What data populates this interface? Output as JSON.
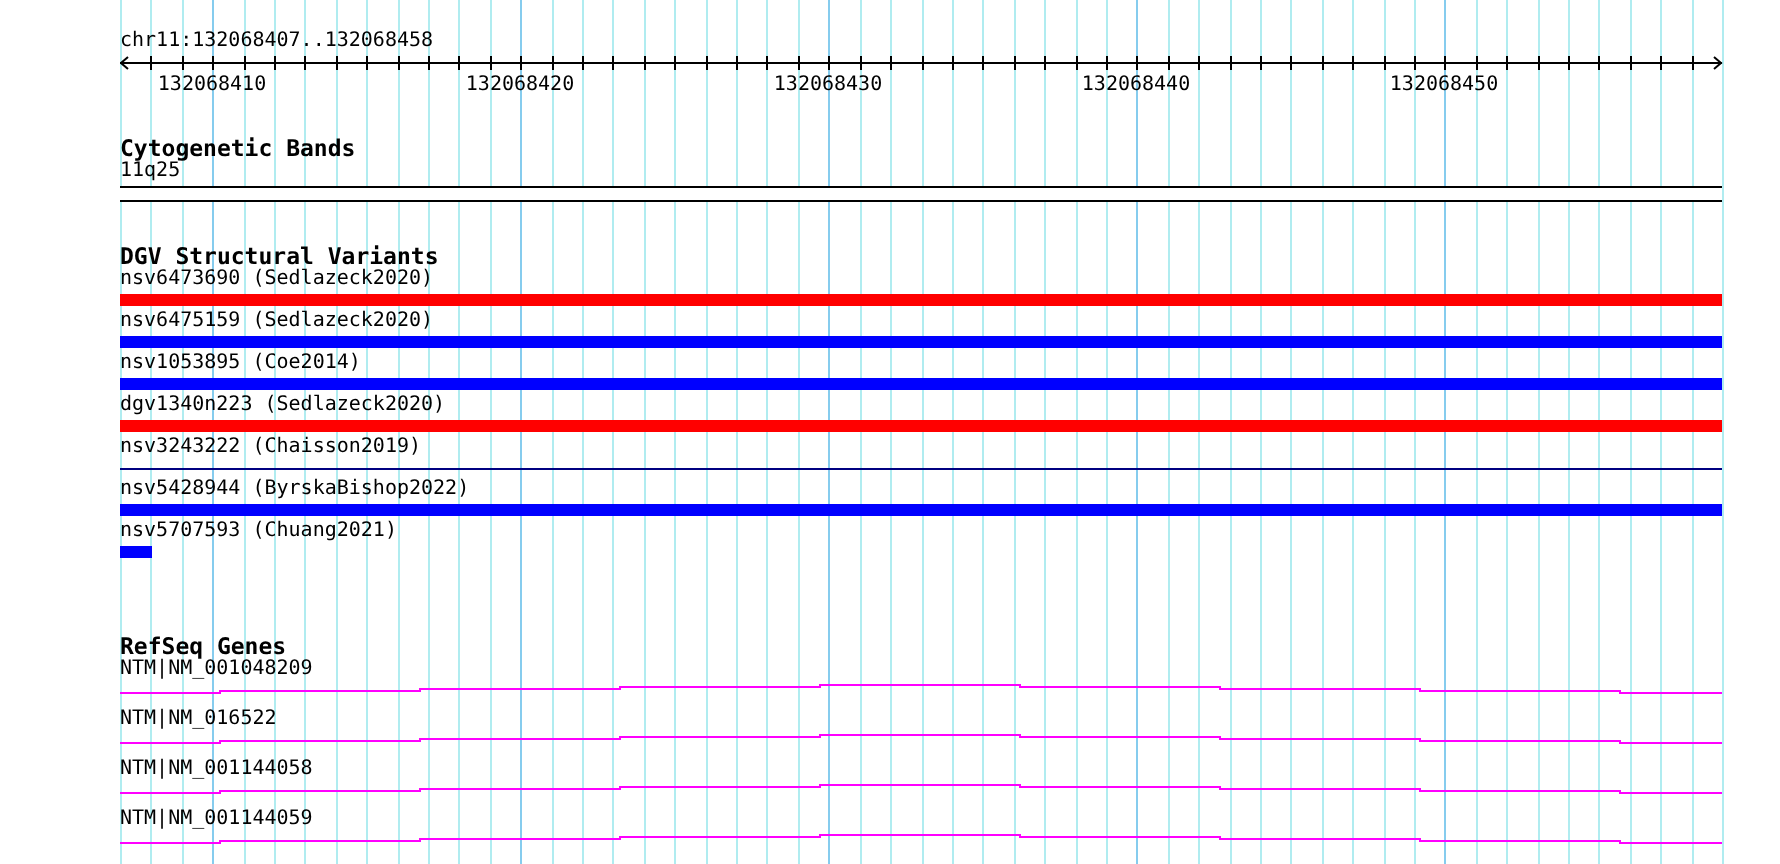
{
  "ruler": {
    "location": "chr11:132068407..132068458",
    "ticks": [
      "132068410",
      "132068420",
      "132068430",
      "132068440",
      "132068450"
    ]
  },
  "tracks": [
    {
      "kind": "cytoband",
      "title": "Cytogenetic Bands",
      "features": [
        {
          "label": "11q25"
        }
      ]
    },
    {
      "kind": "variants",
      "title": "DGV Structural Variants",
      "features": [
        {
          "label": "nsv6473690 (Sedlazeck2020)",
          "kind": "bar",
          "color": "#ff0000"
        },
        {
          "label": "nsv6475159 (Sedlazeck2020)",
          "kind": "bar",
          "color": "#0000ff"
        },
        {
          "label": "nsv1053895 (Coe2014)",
          "kind": "bar",
          "color": "#0000ff"
        },
        {
          "label": "dgv1340n223 (Sedlazeck2020)",
          "kind": "bar",
          "color": "#ff0000"
        },
        {
          "label": "nsv3243222 (Chaisson2019)",
          "kind": "line",
          "color": "#000080"
        },
        {
          "label": "nsv5428944 (ByrskaBishop2022)",
          "kind": "bar",
          "color": "#0000ff"
        },
        {
          "label": "nsv5707593 (Chuang2021)",
          "kind": "stub",
          "color": "#0000ff"
        }
      ]
    },
    {
      "kind": "genes",
      "title": "RefSeq Genes",
      "features": [
        {
          "label": "NTM|NM_001048209"
        },
        {
          "label": "NTM|NM_016522"
        },
        {
          "label": "NTM|NM_001144058"
        },
        {
          "label": "NTM|NM_001144059"
        }
      ]
    }
  ]
}
